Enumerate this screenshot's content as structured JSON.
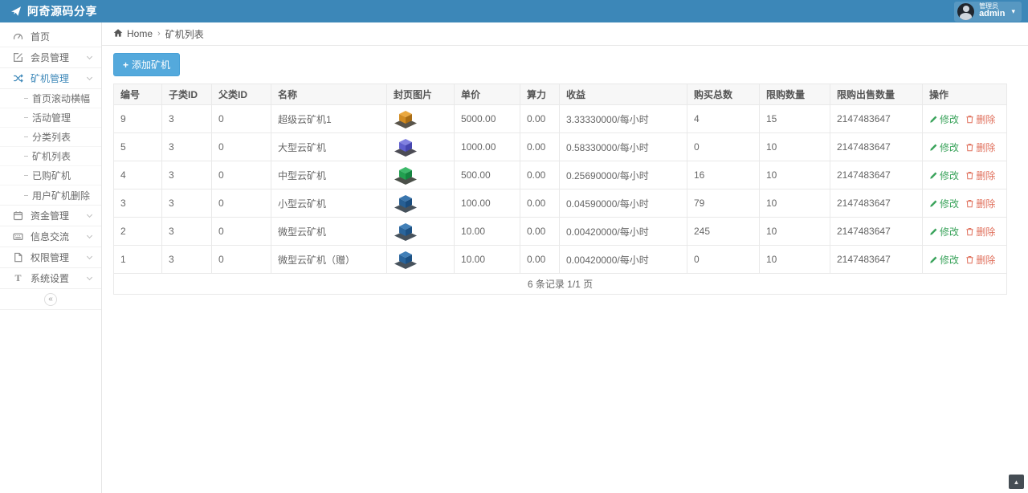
{
  "navbar": {
    "brand": "阿奇源码分享",
    "user": {
      "role": "管理员",
      "name": "admin"
    }
  },
  "sidebar": {
    "items": [
      {
        "label": "首页"
      },
      {
        "label": "会员管理"
      },
      {
        "label": "矿机管理",
        "children": [
          "首页滚动横幅",
          "活动管理",
          "分类列表",
          "矿机列表",
          "已购矿机",
          "用户矿机删除"
        ]
      },
      {
        "label": "资金管理"
      },
      {
        "label": "信息交流"
      },
      {
        "label": "权限管理"
      },
      {
        "label": "系统设置"
      }
    ]
  },
  "breadcrumb": {
    "home": "Home",
    "separator": "›",
    "current": "矿机列表"
  },
  "toolbar": {
    "add_button": "添加矿机"
  },
  "icons": {
    "plus": "+",
    "caret_down": "▾",
    "collapse": "«",
    "back_to_top": "▲"
  },
  "colors": {
    "navbar": "#3c87b8",
    "accent": "#3c87b8",
    "button": "#54a9dc",
    "edit_link": "#3aa35b",
    "delete_link": "#e0705c"
  },
  "table": {
    "headers": [
      "编号",
      "子类ID",
      "父类ID",
      "名称",
      "封页图片",
      "单价",
      "算力",
      "收益",
      "购买总数",
      "限购数量",
      "限购出售数量",
      "操作"
    ],
    "actions": {
      "edit": "修改",
      "delete": "删除"
    },
    "footer": "6 条记录 1/1 页",
    "rows": [
      {
        "id": "9",
        "sub_id": "3",
        "parent_id": "0",
        "name": "超级云矿机1",
        "price": "5000.00",
        "power": "0.00",
        "income": "3.33330000/每小时",
        "bought": "4",
        "limit_buy": "15",
        "limit_sell": "2147483647",
        "image": {
          "base": "#59544a",
          "top": "#eaa83f",
          "left": "#d18b22",
          "right": "#a96d15"
        }
      },
      {
        "id": "5",
        "sub_id": "3",
        "parent_id": "0",
        "name": "大型云矿机",
        "price": "1000.00",
        "power": "0.00",
        "income": "0.58330000/每小时",
        "bought": "0",
        "limit_buy": "10",
        "limit_sell": "2147483647",
        "image": {
          "base": "#4c4c55",
          "top": "#8181e0",
          "left": "#5f5fcd",
          "right": "#4646b0"
        }
      },
      {
        "id": "4",
        "sub_id": "3",
        "parent_id": "0",
        "name": "中型云矿机",
        "price": "500.00",
        "power": "0.00",
        "income": "0.25690000/每小时",
        "bought": "16",
        "limit_buy": "10",
        "limit_sell": "2147483647",
        "image": {
          "base": "#4b5049",
          "top": "#3cb96a",
          "left": "#22a050",
          "right": "#158540"
        }
      },
      {
        "id": "3",
        "sub_id": "3",
        "parent_id": "0",
        "name": "小型云矿机",
        "price": "100.00",
        "power": "0.00",
        "income": "0.04590000/每小时",
        "bought": "79",
        "limit_buy": "10",
        "limit_sell": "2147483647",
        "image": {
          "base": "#47525c",
          "top": "#3a76ae",
          "left": "#275f94",
          "right": "#1a4c7e"
        }
      },
      {
        "id": "2",
        "sub_id": "3",
        "parent_id": "0",
        "name": "微型云矿机",
        "price": "10.00",
        "power": "0.00",
        "income": "0.00420000/每小时",
        "bought": "245",
        "limit_buy": "10",
        "limit_sell": "2147483647",
        "image": {
          "base": "#47525c",
          "top": "#4280b8",
          "left": "#2a659c",
          "right": "#1c5184"
        }
      },
      {
        "id": "1",
        "sub_id": "3",
        "parent_id": "0",
        "name": "微型云矿机（赠）",
        "price": "10.00",
        "power": "0.00",
        "income": "0.00420000/每小时",
        "bought": "0",
        "limit_buy": "10",
        "limit_sell": "2147483647",
        "image": {
          "base": "#47525c",
          "top": "#4280b8",
          "left": "#2a659c",
          "right": "#1c5184"
        }
      }
    ]
  }
}
